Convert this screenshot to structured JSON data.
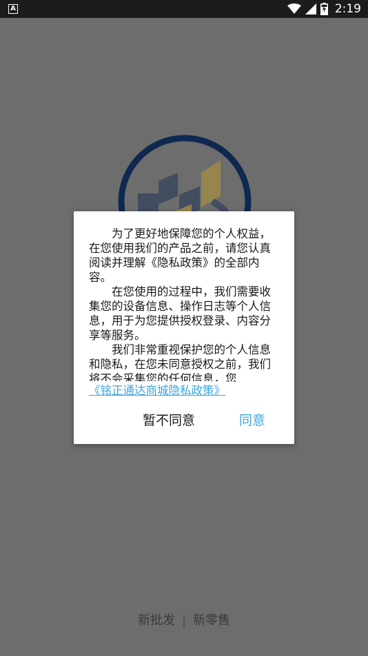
{
  "status_bar": {
    "notification_icon_letter": "A",
    "time": "2:19"
  },
  "splash": {
    "tagline_left": "新批发",
    "tagline_sep": "|",
    "tagline_right": "新零售",
    "colors": {
      "logo_navy": "#0f2850",
      "logo_gold": "#c9a227"
    }
  },
  "dialog": {
    "paragraphs": [
      "为了更好地保障您的个人权益，在您使用我们的产品之前，请您认真阅读并理解《隐私政策》的全部内容。",
      "在您使用的过程中，我们需要收集您的设备信息、操作日志等个人信息，用于为您提供授权登录、内容分享等服务。",
      "我们非常重视保护您的个人信息和隐私，在您未同意授权之前，我们将不会采集您的任何信息，您"
    ],
    "policy_link": "《铭正通达商城隐私政策》",
    "disagree_label": "暂不同意",
    "agree_label": "同意",
    "colors": {
      "accent": "#3ea5dc"
    }
  }
}
